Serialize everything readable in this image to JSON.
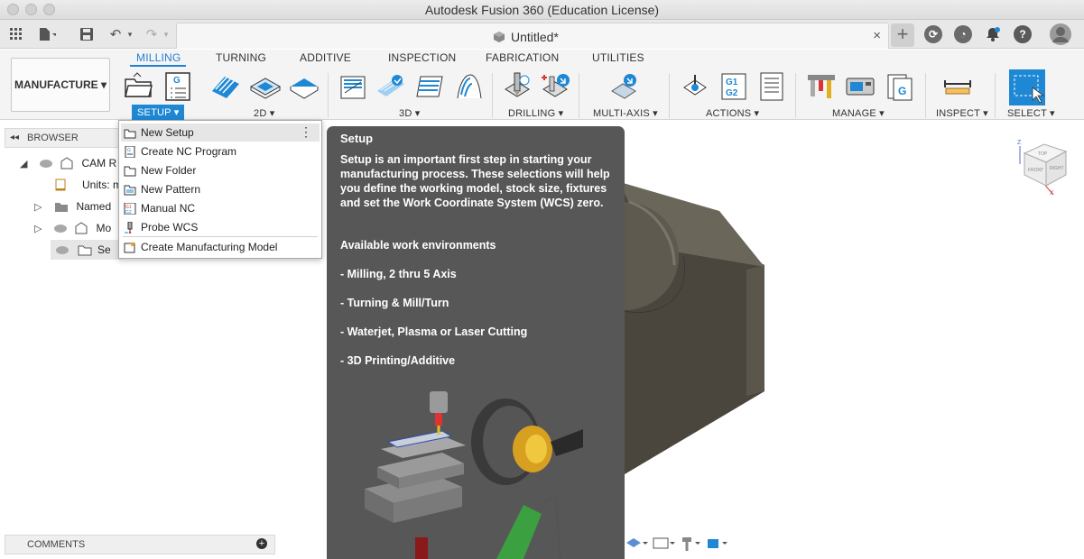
{
  "window": {
    "title": "Autodesk Fusion 360 (Education License)"
  },
  "document": {
    "title": "Untitled*",
    "close": "×"
  },
  "workspace": {
    "label": "MANUFACTURE ▾"
  },
  "ribbon": {
    "tabs": [
      "MILLING",
      "TURNING",
      "ADDITIVE",
      "INSPECTION",
      "FABRICATION",
      "UTILITIES"
    ],
    "active_tab": "MILLING",
    "groups": [
      "SETUP ▾",
      "2D ▾",
      "3D ▾",
      "DRILLING ▾",
      "MULTI-AXIS ▾",
      "ACTIONS ▾",
      "MANAGE ▾",
      "INSPECT ▾",
      "SELECT ▾"
    ]
  },
  "browser": {
    "header": "BROWSER",
    "rows": [
      "CAM R",
      "Units: m",
      "Named",
      "Mo",
      "Se"
    ]
  },
  "setup_menu": {
    "items": [
      {
        "label": "New Setup",
        "icon": "new-setup-icon"
      },
      {
        "label": "Create NC Program",
        "icon": "nc-program-icon"
      },
      {
        "label": "New Folder",
        "icon": "folder-icon"
      },
      {
        "label": "New Pattern",
        "icon": "pattern-icon"
      },
      {
        "label": "Manual NC",
        "icon": "manual-nc-icon"
      },
      {
        "label": "Probe WCS",
        "icon": "probe-icon"
      },
      {
        "label": "Create Manufacturing Model",
        "icon": "manufacturing-model-icon"
      }
    ]
  },
  "tooltip": {
    "title": "Setup",
    "body": "Setup is an important first step in starting your manufacturing process. These selections will help you define the working model, stock size, fixtures and set the Work Coordinate System (WCS) zero.",
    "env_heading": "Available work environments",
    "envs": [
      "- Milling, 2 thru 5 Axis",
      "- Turning & Mill/Turn",
      "- Waterjet, Plasma or Laser Cutting",
      "- 3D Printing/Additive"
    ]
  },
  "viewcube": {
    "faces": [
      "TOP",
      "FRONT",
      "RIGHT"
    ]
  },
  "comments": {
    "label": "COMMENTS"
  },
  "colors": {
    "accent": "#1e88d4",
    "tooltip_bg": "#575757",
    "model": "#4a463d"
  }
}
